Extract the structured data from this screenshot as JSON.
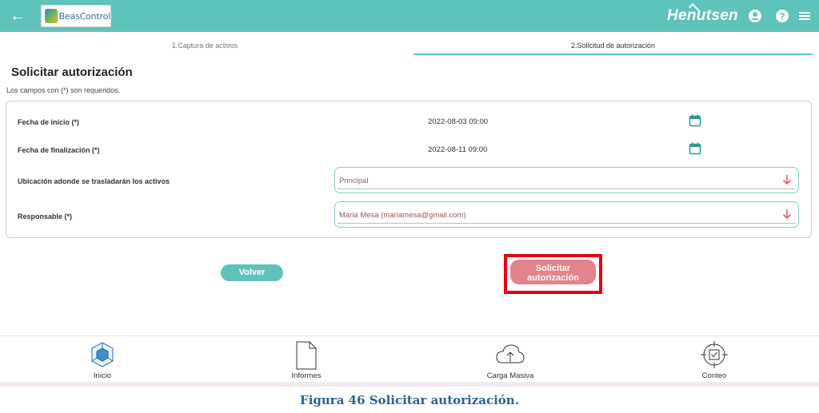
{
  "header": {
    "logo_text": "BeasControl",
    "brand": "Henutsen",
    "icons": [
      "back-arrow-icon",
      "account-icon",
      "help-icon",
      "menu-icon"
    ]
  },
  "tabs": [
    {
      "label": "1.Captura de activos",
      "active": false
    },
    {
      "label": "2.Solicitud de autorización",
      "active": true
    }
  ],
  "form": {
    "title": "Solicitar autorización",
    "required_note": "Los campos con (*) son requeridos.",
    "start_date": {
      "label": "Fecha de inicio (*)",
      "value": "2022-08-03 09:00"
    },
    "end_date": {
      "label": "Fecha de finalización (*)",
      "value": "2022-08-11 09:00"
    },
    "location": {
      "label": "Ubicación adonde se trasladarán los activos",
      "value": "Principal"
    },
    "responsible": {
      "label": "Responsable (*)",
      "value": "Maria Mesa (mariamesa@gmail.com)"
    }
  },
  "buttons": {
    "back": "Volver",
    "submit_line1": "Solicitar",
    "submit_line2": "autorización"
  },
  "bottom_nav": [
    {
      "label": "Inicio",
      "icon": "home-cube-icon"
    },
    {
      "label": "Informes",
      "icon": "document-icon"
    },
    {
      "label": "Carga Masiva",
      "icon": "cloud-upload-icon"
    },
    {
      "label": "Conteo",
      "icon": "target-check-icon"
    }
  ],
  "caption": "Figura 46 Solicitar autorización.",
  "colors": {
    "primary": "#5ec3bb",
    "submit": "#e3838b",
    "highlight": "#e4000f",
    "caption": "#2f5f96"
  }
}
